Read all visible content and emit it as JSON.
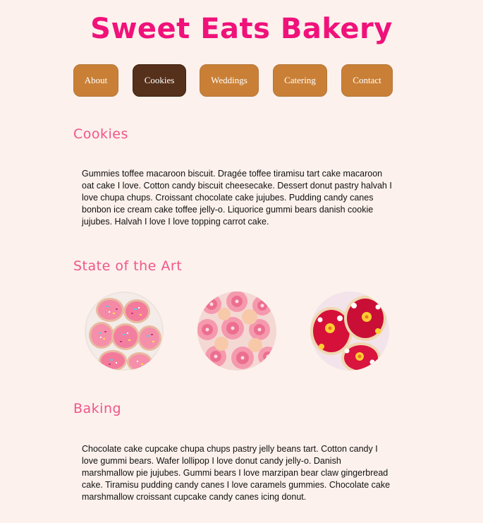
{
  "header": {
    "title": "Sweet Eats Bakery"
  },
  "nav": {
    "items": [
      {
        "label": "About",
        "active": false
      },
      {
        "label": "Cookies",
        "active": true
      },
      {
        "label": "Weddings",
        "active": false
      },
      {
        "label": "Catering",
        "active": false
      },
      {
        "label": "Contact",
        "active": false
      }
    ]
  },
  "cookies_section": {
    "heading": "Cookies",
    "body": "Gummies toffee macaroon biscuit. Dragée toffee tiramisu tart cake macaroon oat cake I love. Cotton candy biscuit cheesecake. Dessert donut pastry halvah I love chupa chups. Croissant chocolate cake jujubes. Pudding candy canes bonbon ice cream cake toffee jelly-o. Liquorice gummi bears danish cookie jujubes. Halvah I love I love topping carrot cake."
  },
  "gallery_section": {
    "heading": "State of the Art",
    "images": [
      {
        "name": "pink-frosted-sprinkle-cookies-image"
      },
      {
        "name": "pink-flower-cookies-image"
      },
      {
        "name": "red-flower-cookies-image"
      }
    ]
  },
  "baking_section": {
    "heading": "Baking",
    "body": "Chocolate cake cupcake chupa chups pastry jelly beans tart. Cotton candy I love gummi bears. Wafer lollipop I love donut candy jelly-o. Danish marshmallow pie jujubes. Gummi bears I love marzipan bear claw gingerbread cake. Tiramisu pudding candy canes I love caramels gummies. Chocolate cake marshmallow croissant cupcake candy canes icing donut."
  },
  "colors": {
    "background": "#fcf1ec",
    "title": "#f0127a",
    "heading": "#f0558a",
    "nav_button": "#c98036",
    "nav_button_active": "#55301a"
  }
}
